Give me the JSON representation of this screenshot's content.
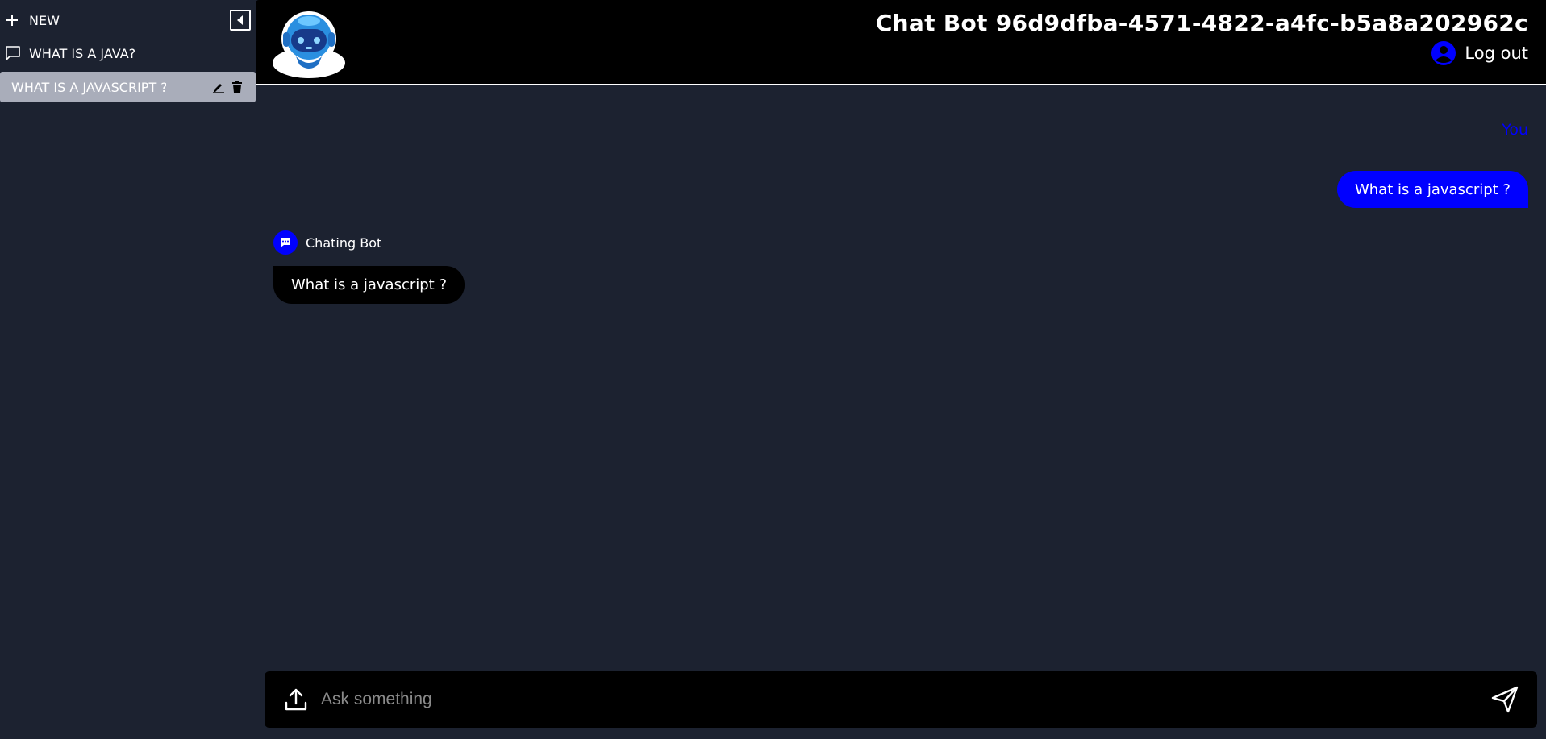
{
  "sidebar": {
    "new_label": "NEW",
    "items": [
      {
        "label": "WHAT IS A JAVA?"
      },
      {
        "label": "WHAT IS A JAVASCRIPT ?"
      }
    ]
  },
  "header": {
    "title": "Chat Bot 96d9dfba-4571-4822-a4fc-b5a8a202962c",
    "logout_label": "Log out"
  },
  "chat": {
    "user_label": "You",
    "user_message": "What is a javascript ?",
    "bot_name": "Chating Bot",
    "bot_message": "What is a javascript ?"
  },
  "input": {
    "placeholder": "Ask something",
    "value": ""
  },
  "colors": {
    "background": "#1c2230",
    "header": "#000000",
    "accent": "#0000ff",
    "active_item": "#a9adba"
  }
}
